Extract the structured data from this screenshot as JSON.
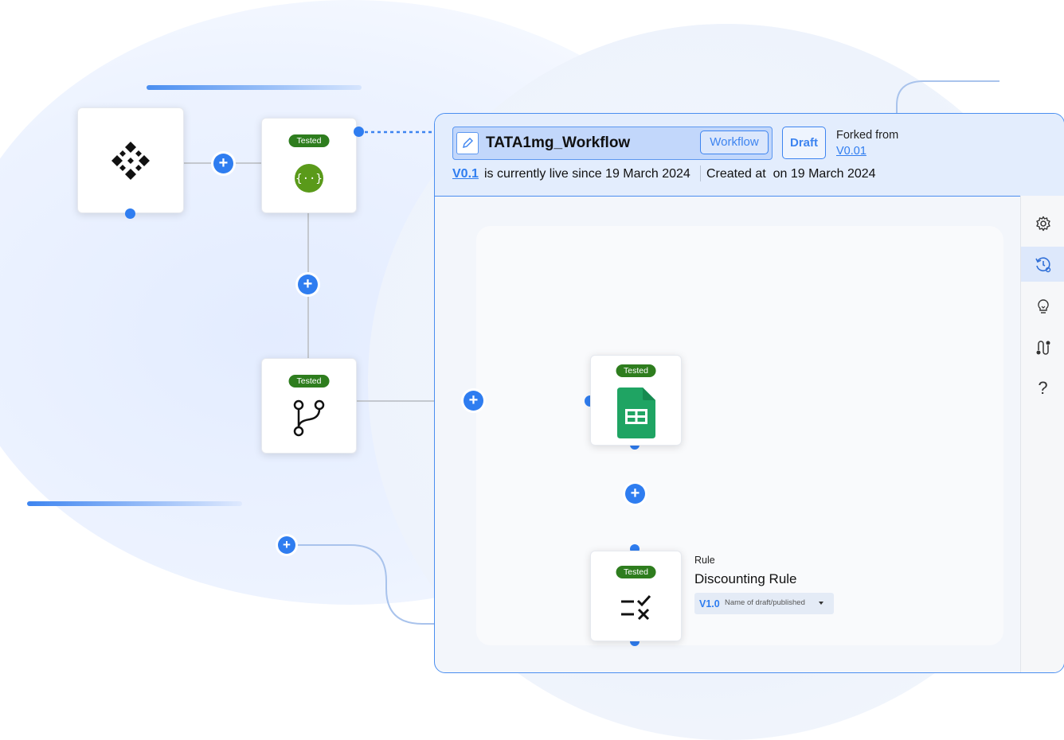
{
  "workflow": {
    "title": "TATA1mg_Workflow",
    "workflow_button": "Workflow",
    "status_button": "Draft",
    "forked_label": "Forked from",
    "forked_version": "V0.01",
    "live_version": "V0.1",
    "live_text": "is currently live since 19 March 2024",
    "created_text": "Created at  on 19 March 2024"
  },
  "nodes": {
    "tested_label": "Tested"
  },
  "rule": {
    "type_label": "Rule",
    "name": "Discounting Rule",
    "version": "V1.0",
    "version_placeholder": "Name of draft/published"
  },
  "rail": {
    "items": [
      "gear-icon",
      "history-settings-icon",
      "lightbulb-icon",
      "route-icon",
      "help-icon"
    ],
    "help_glyph": "?"
  },
  "colors": {
    "accent": "#2f7df0",
    "tested_badge": "#2e7d1e",
    "sheets_green": "#1fa463",
    "json_green": "#5a9a1a"
  }
}
